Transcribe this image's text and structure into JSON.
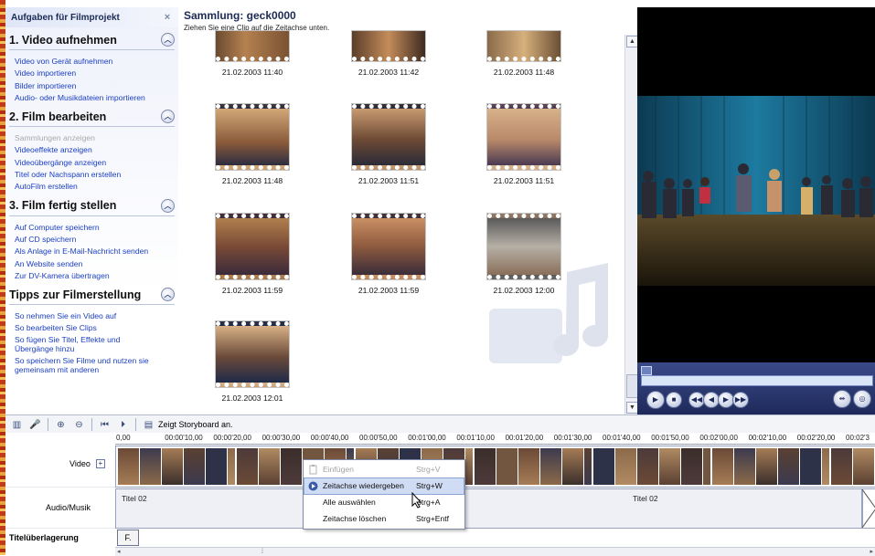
{
  "taskpane": {
    "title": "Aufgaben für Filmprojekt",
    "sections": [
      {
        "title": "1. Video aufnehmen",
        "links": [
          {
            "label": "Video von Gerät aufnehmen"
          },
          {
            "label": "Video importieren"
          },
          {
            "label": "Bilder importieren"
          },
          {
            "label": "Audio- oder Musikdateien importieren"
          }
        ]
      },
      {
        "title": "2. Film bearbeiten",
        "links": [
          {
            "label": "Sammlungen anzeigen",
            "disabled": true
          },
          {
            "label": "Videoeffekte anzeigen"
          },
          {
            "label": "Videoübergänge anzeigen"
          },
          {
            "label": "Titel oder Nachspann erstellen"
          },
          {
            "label": "AutoFilm erstellen"
          }
        ]
      },
      {
        "title": "3. Film fertig stellen",
        "links": [
          {
            "label": "Auf Computer speichern"
          },
          {
            "label": "Auf CD speichern"
          },
          {
            "label": "Als Anlage in E-Mail-Nachricht senden"
          },
          {
            "label": "An Website senden"
          },
          {
            "label": "Zur DV-Kamera übertragen"
          }
        ]
      },
      {
        "title": "Tipps zur Filmerstellung",
        "links": [
          {
            "label": "So nehmen Sie ein Video auf"
          },
          {
            "label": "So bearbeiten Sie Clips"
          },
          {
            "label": "So fügen Sie Titel, Effekte und Übergänge hinzu"
          },
          {
            "label": "So speichern Sie Filme und nutzen sie gemeinsam mit anderen"
          }
        ]
      }
    ]
  },
  "collection": {
    "title": "Sammlung: geck0000",
    "subtitle": "Ziehen Sie eine Clip auf die Zeitachse unten.",
    "clips": [
      {
        "label": "21.02.2003 11:40"
      },
      {
        "label": "21.02.2003 11:42"
      },
      {
        "label": "21.02.2003 11:48"
      },
      {
        "label": "21.02.2003 11:48"
      },
      {
        "label": "21.02.2003 11:51"
      },
      {
        "label": "21.02.2003 11:51"
      },
      {
        "label": "21.02.2003 11:59"
      },
      {
        "label": "21.02.2003 11:59"
      },
      {
        "label": "21.02.2003 12:00"
      },
      {
        "label": "21.02.2003 12:01"
      }
    ]
  },
  "toolbar": {
    "storyboard_label": "Zeigt Storyboard an."
  },
  "timeline": {
    "ruler_ticks": [
      "0,00",
      "00:00'10,00",
      "00:00'20,00",
      "00:00'30,00",
      "00:00'40,00",
      "00:00'50,00",
      "00:01'00,00",
      "00:01'10,00",
      "00:01'20,00",
      "00:01'30,00",
      "00:01'40,00",
      "00:01'50,00",
      "00:02'00,00",
      "00:02'10,00",
      "00:02'20,00",
      "00:02'3"
    ],
    "video_label": "Video",
    "audio_label": "Audio/Musik",
    "title_label": "Titelüberlagerung",
    "audio_clips": [
      "Titel 02",
      "Titel 02"
    ],
    "title_clip": "F."
  },
  "context_menu": {
    "items": [
      {
        "label": "Einfügen",
        "shortcut": "Strg+V",
        "disabled": true
      },
      {
        "label": "Zeitachse wiedergeben",
        "shortcut": "Strg+W",
        "hover": true
      },
      {
        "label": "Alle auswählen",
        "shortcut": "Strg+A"
      },
      {
        "label": "Zeitachse löschen",
        "shortcut": "Strg+Entf"
      }
    ]
  }
}
